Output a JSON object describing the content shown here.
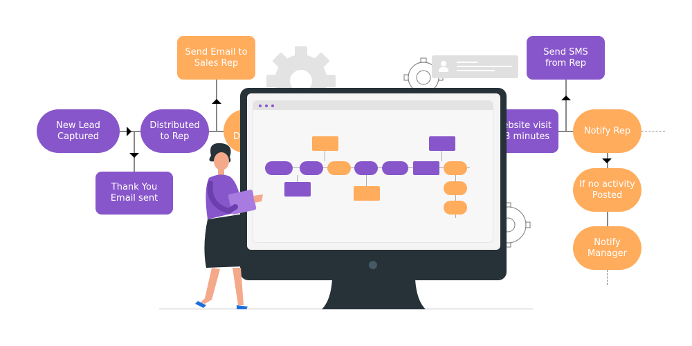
{
  "colors": {
    "purple": "#8856CB",
    "orange": "#FFAC5C",
    "monitor": "#263238",
    "gear": "#e0e0e0"
  },
  "flow": {
    "new_lead": "New Lead\nCaptured",
    "thank_you": "Thank You\nEmail sent",
    "distributed": "Distributed\nto Rep",
    "send_email": "Send Email to\nSales Rep",
    "hidden_orange": "D",
    "website_visit": "ebsite visit\n3 minutes",
    "send_sms": "Send SMS\nfrom Rep",
    "notify_rep": "Notify Rep",
    "no_activity": "If no activity\nPosted",
    "notify_manager": "Notify\nManager"
  },
  "icons": [
    "gear-icon",
    "user-icon",
    "monitor-icon"
  ]
}
